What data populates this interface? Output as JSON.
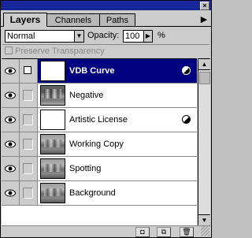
{
  "panel": {
    "tabs": [
      {
        "label": "Layers",
        "active": true
      },
      {
        "label": "Channels",
        "active": false
      },
      {
        "label": "Paths",
        "active": false
      }
    ],
    "menu_arrow": "▶"
  },
  "blend": {
    "mode": "Normal",
    "opacity_label": "Opacity:",
    "opacity_value": "100",
    "percent": "%"
  },
  "preserve_transparency": {
    "label": "Preserve Transparency",
    "checked": false,
    "enabled": false
  },
  "layers": [
    {
      "name": "VDB Curve",
      "thumb": "white",
      "adjustment": true,
      "selected": true,
      "visible": true,
      "paint_icon": true
    },
    {
      "name": "Negative",
      "thumb": "neg",
      "adjustment": false,
      "selected": false,
      "visible": true,
      "paint_icon": false
    },
    {
      "name": "Artistic License",
      "thumb": "white",
      "adjustment": true,
      "selected": false,
      "visible": true,
      "paint_icon": false
    },
    {
      "name": "Working Copy",
      "thumb": "photo",
      "adjustment": false,
      "selected": false,
      "visible": true,
      "paint_icon": false
    },
    {
      "name": "Spotting",
      "thumb": "photo",
      "adjustment": false,
      "selected": false,
      "visible": true,
      "paint_icon": false
    },
    {
      "name": "Background",
      "thumb": "photo",
      "adjustment": false,
      "selected": false,
      "visible": true,
      "paint_icon": false
    }
  ],
  "icons": {
    "close": "close-icon",
    "eye": "eye-icon",
    "adjustment": "adjustment-layer-icon",
    "mask": "mask-icon",
    "new_layer": "new-layer-icon",
    "trash": "trash-icon"
  },
  "colors": {
    "selection": "#000080",
    "panel_bg": "#cccccc"
  }
}
